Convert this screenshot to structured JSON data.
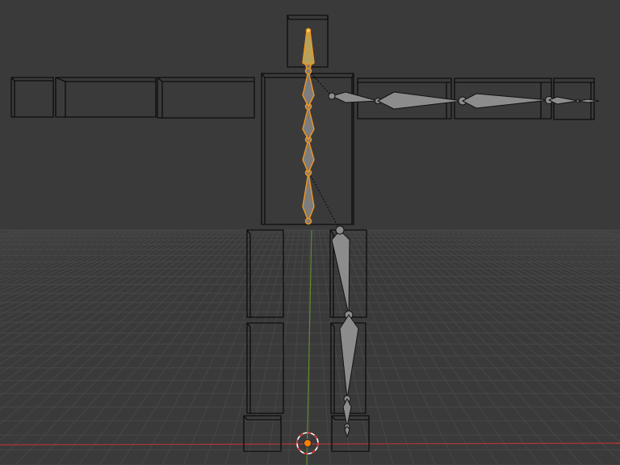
{
  "viewport": {
    "background": "#3a3a3a",
    "grid_color": "#474747",
    "x_axis_color": "#b03535",
    "y_axis_color": "#5e8a2c"
  },
  "mesh": {
    "wire_color": "#0d0d0d",
    "parts": [
      "head",
      "torso",
      "left-upper-arm",
      "left-forearm",
      "left-hand",
      "right-upper-arm",
      "right-forearm",
      "right-hand",
      "right-thigh",
      "right-shin",
      "right-foot",
      "left-thigh",
      "left-shin",
      "left-foot"
    ]
  },
  "armature": {
    "bone_fill": "#8c8c8c",
    "bone_outline": "#111111",
    "selected_fill": "#7d7d7d",
    "selected_outline": "#f2961f",
    "active_tip": "#f5d27a",
    "spine_bones": [
      "spine-1",
      "spine-2",
      "spine-3",
      "spine-4",
      "neck-head"
    ],
    "arm_bones": [
      "upper-arm",
      "forearm",
      "hand",
      "finger"
    ],
    "leg_bones": [
      "thigh",
      "shin",
      "foot",
      "toe"
    ]
  },
  "cursor_3d": {
    "ring_color": "#ffffff",
    "dash_color": "#e03030",
    "center_color": "#ff7f00"
  }
}
